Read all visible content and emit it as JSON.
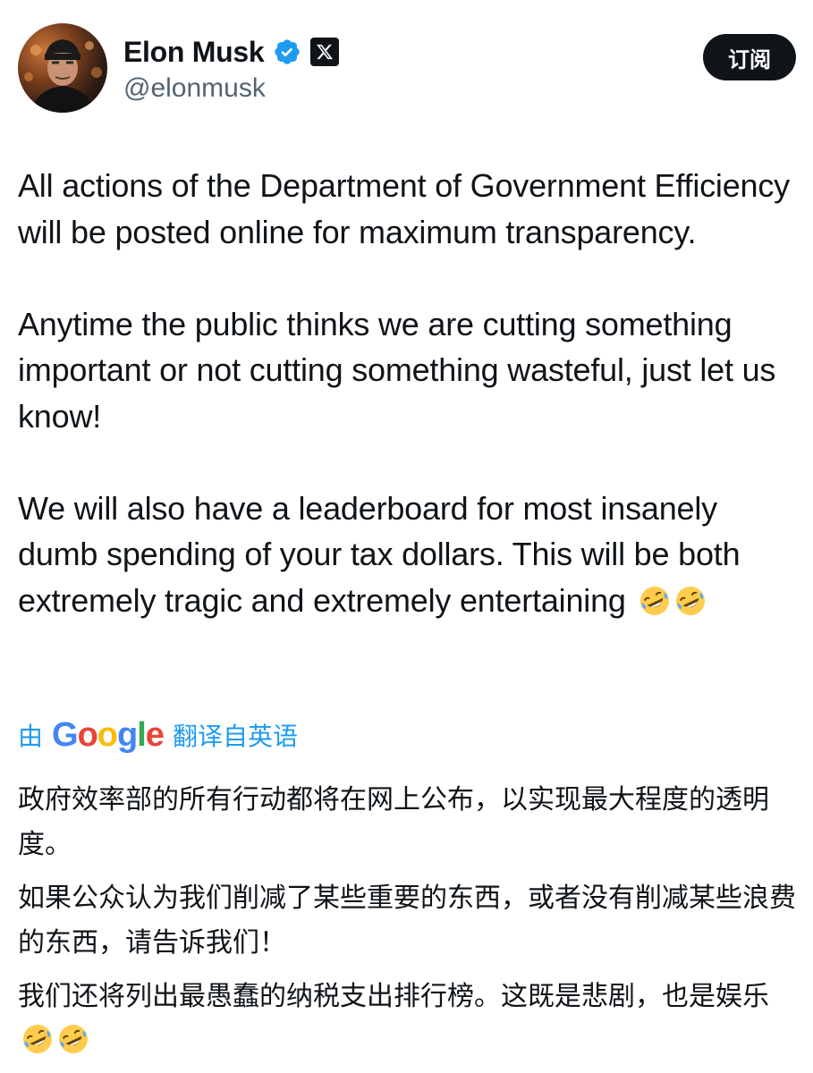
{
  "author": {
    "display_name": "Elon Musk",
    "handle": "@elonmusk"
  },
  "icons": {
    "verified": "verified-badge-icon",
    "affiliate": "x-logo-icon",
    "avatar": "profile-photo",
    "emoji": "rolling-on-floor-laughing-emoji"
  },
  "colors": {
    "verified": "#1d9bf0",
    "link": "#1d9bf0",
    "button_bg": "#0f1419"
  },
  "subscribe_label": "订阅",
  "tweet": {
    "paragraphs": [
      "All actions of the Department of Government Efficiency will be posted online for maximum transparency.",
      "Anytime the public thinks we are cutting something important or not cutting something wasteful, just let us know!",
      "We will also have a leaderboard for most insanely dumb spending of your tax dollars. This will be both extremely tragic and extremely entertaining"
    ]
  },
  "translation": {
    "prefix": "由",
    "provider": "Google",
    "suffix": "翻译自英语",
    "paragraphs": [
      "政府效率部的所有行动都将在网上公布，以实现最大程度的透明度。",
      "如果公众认为我们削减了某些重要的东西，或者没有削减某些浪费的东西，请告诉我们！",
      "我们还将列出最愚蠢的纳税支出排行榜。这既是悲剧，也是娱乐"
    ]
  }
}
